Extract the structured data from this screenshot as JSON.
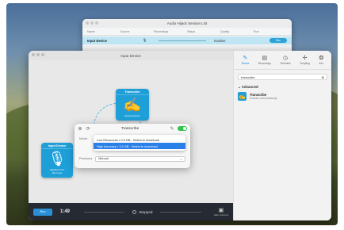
{
  "session_window": {
    "title": "Audio Hijack Session List",
    "columns": [
      "Name",
      "Source",
      "Recordings",
      "Status",
      "Quality",
      "Run"
    ],
    "row": {
      "name": "Input Device",
      "status": "Inactive",
      "run_label": "Run"
    }
  },
  "main_window": {
    "title": "Input Device",
    "nodes": {
      "transcribe": {
        "header": "Transcribe",
        "subtitle": "Speech Detect"
      },
      "input": {
        "header": "Input Device",
        "line1": "MacBook Pro",
        "line2": "Mic Input"
      }
    },
    "popup": {
      "title": "Transcribe",
      "model_label": "Model",
      "options": [
        "Low Resources • 0.5 GB - Select to download",
        "High Accuracy • 3.0 GB - Select to download"
      ],
      "selected_index": 1,
      "pronoun_label": "Pronouns",
      "pronoun_value": "Manual"
    },
    "bottom_bar": {
      "run_label": "Run",
      "time": "1:49",
      "status": "Stopped",
      "icon_label": "Hide Controls"
    }
  },
  "panel": {
    "tabs": [
      {
        "label": "Blocks",
        "icon": "blocks-icon",
        "glyph": "✎",
        "active": true
      },
      {
        "label": "Recordings",
        "icon": "recordings-icon",
        "glyph": "▤",
        "active": false
      },
      {
        "label": "Schedule",
        "icon": "schedule-icon",
        "glyph": "◷",
        "active": false
      },
      {
        "label": "Scripting",
        "icon": "scripting-icon",
        "glyph": "✢",
        "active": false
      },
      {
        "label": "Info",
        "icon": "info-icon",
        "glyph": "❂",
        "active": false
      }
    ],
    "search_value": "transcribe",
    "section": "Advanced",
    "item": {
      "title": "Transcribe",
      "subtitle": "Produce a text transcript"
    }
  }
}
